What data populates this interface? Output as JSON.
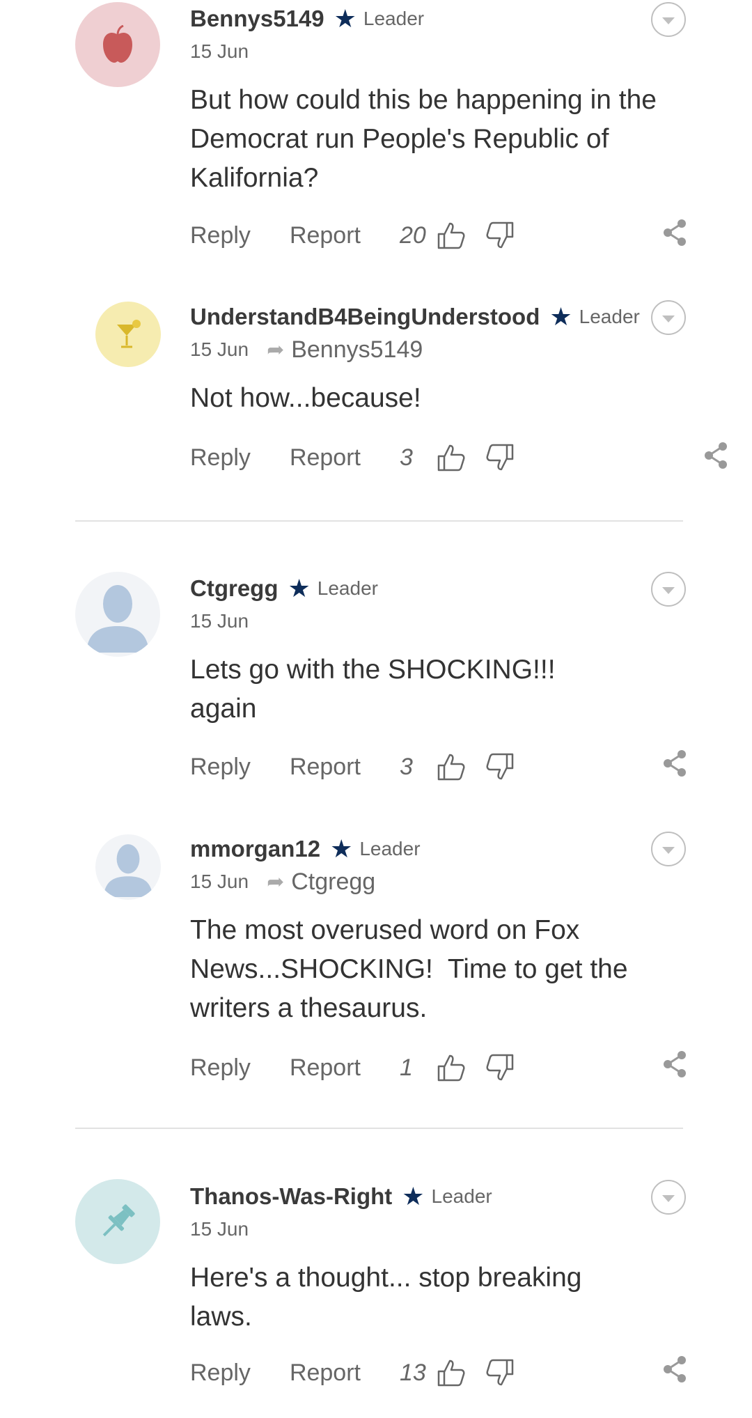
{
  "colors": {
    "star": "#0e2d5a",
    "text": "#333333",
    "muted": "#666666",
    "divider": "#e2e2e2"
  },
  "comments": [
    {
      "user": "Bennys5149",
      "role": "Leader",
      "date": "15 Jun",
      "reply_to": "",
      "text": "But how could this be happening in the Democrat run People's Republic of Kalifornia?",
      "reply": "Reply",
      "report": "Report",
      "likes": "20",
      "avatar_icon": "apple-icon",
      "avatar_bg": "#efcfd2"
    },
    {
      "user": "UnderstandB4BeingUnderstood",
      "role": "Leader",
      "date": "15 Jun",
      "reply_to": "Bennys5149",
      "text": "Not how...because!",
      "reply": "Reply",
      "report": "Report",
      "likes": "3",
      "avatar_icon": "cocktail-icon",
      "avatar_bg": "#f6ecb0"
    },
    {
      "user": "Ctgregg",
      "role": "Leader",
      "date": "15 Jun",
      "reply_to": "",
      "text": "Lets go with the SHOCKING!!! again",
      "reply": "Reply",
      "report": "Report",
      "likes": "3",
      "avatar_icon": "person-silhouette-icon",
      "avatar_bg": "#f2f4f7"
    },
    {
      "user": "mmorgan12",
      "role": "Leader",
      "date": "15 Jun",
      "reply_to": "Ctgregg",
      "text": "The most overused word on Fox News...SHOCKING!  Time to get the writers a thesaurus.",
      "reply": "Reply",
      "report": "Report",
      "likes": "1",
      "avatar_icon": "person-silhouette-icon",
      "avatar_bg": "#f2f4f7"
    },
    {
      "user": "Thanos-Was-Right",
      "role": "Leader",
      "date": "15 Jun",
      "reply_to": "",
      "text": "Here's a thought... stop breaking laws.",
      "reply": "Reply",
      "report": "Report",
      "likes": "13",
      "avatar_icon": "pushpin-icon",
      "avatar_bg": "#d3e9ea"
    }
  ]
}
